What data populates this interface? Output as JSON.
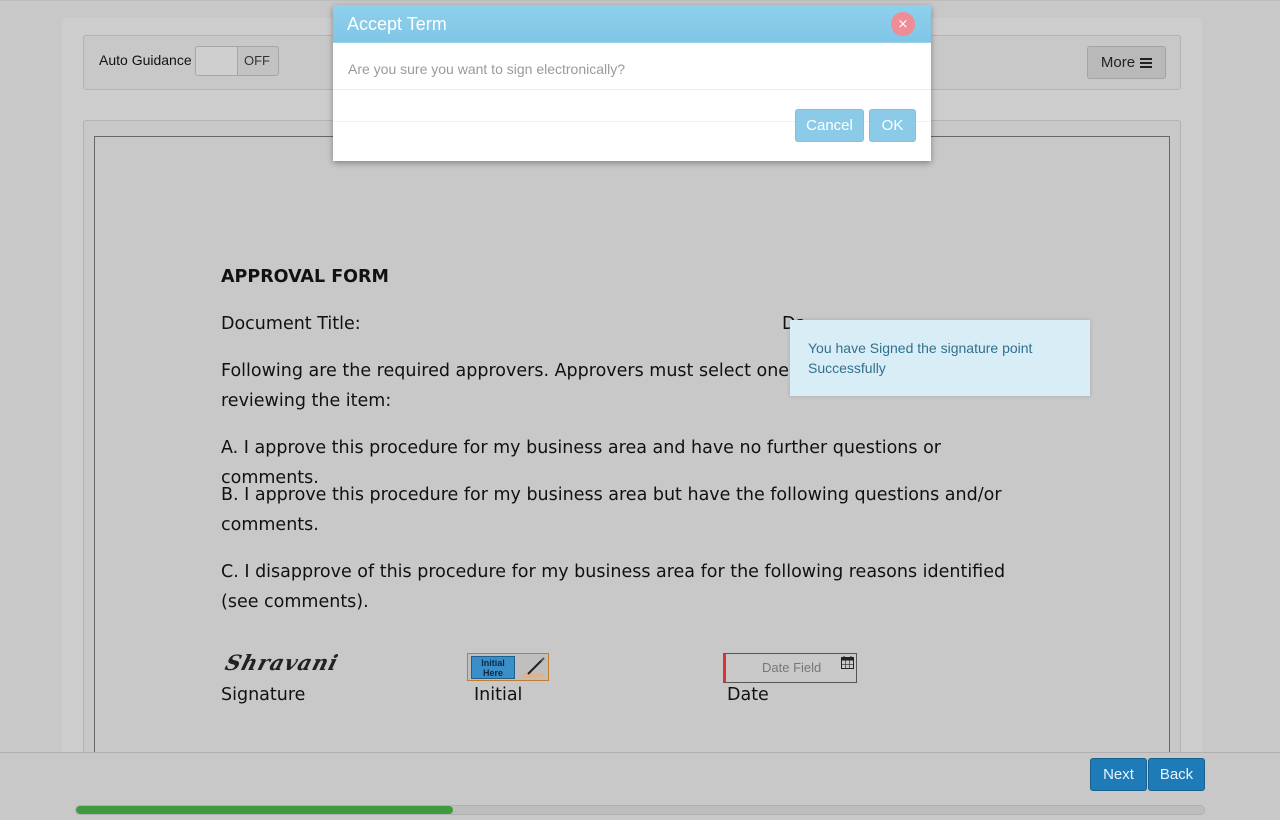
{
  "toolbar": {
    "auto_guidance_label": "Auto Guidance",
    "toggle_state": "OFF",
    "more_label": "More"
  },
  "document": {
    "heading": "APPROVAL FORM",
    "doc_title_label": "Document Title:",
    "date_partial": "Da",
    "following_text": "Following are the required approvers. Approvers must select one o",
    "following_text_2": "reviewing the item:",
    "option_a": "A. I approve this procedure for my business area and have no further questions or comments.",
    "option_b": "B. I approve this procedure for my business area but have the following questions and/or comments.",
    "option_c": "C. I disapprove of this procedure for my business area for the following reasons identified (see comments).",
    "signature_image_text": "Shravani",
    "signature_label": "Signature",
    "initial_tag": "Initial Here",
    "initial_label": "Initial",
    "date_field_placeholder": "Date Field",
    "date_label": "Date"
  },
  "toast": {
    "message": "You have Signed the signature point Successfully"
  },
  "footer": {
    "next_label": "Next",
    "back_label": "Back",
    "progress_fraction": 0.334
  },
  "modal": {
    "title": "Accept Term",
    "close_glyph": "×",
    "message": "Are you sure you want to sign electronically?",
    "cancel_label": "Cancel",
    "ok_label": "OK"
  },
  "colors": {
    "primary_button": "#1f7bb7",
    "modal_header": "#8fd0ec",
    "progress_fill": "#3e9a3e",
    "toast_bg": "#d9edf7",
    "close_button": "#f08c96"
  }
}
